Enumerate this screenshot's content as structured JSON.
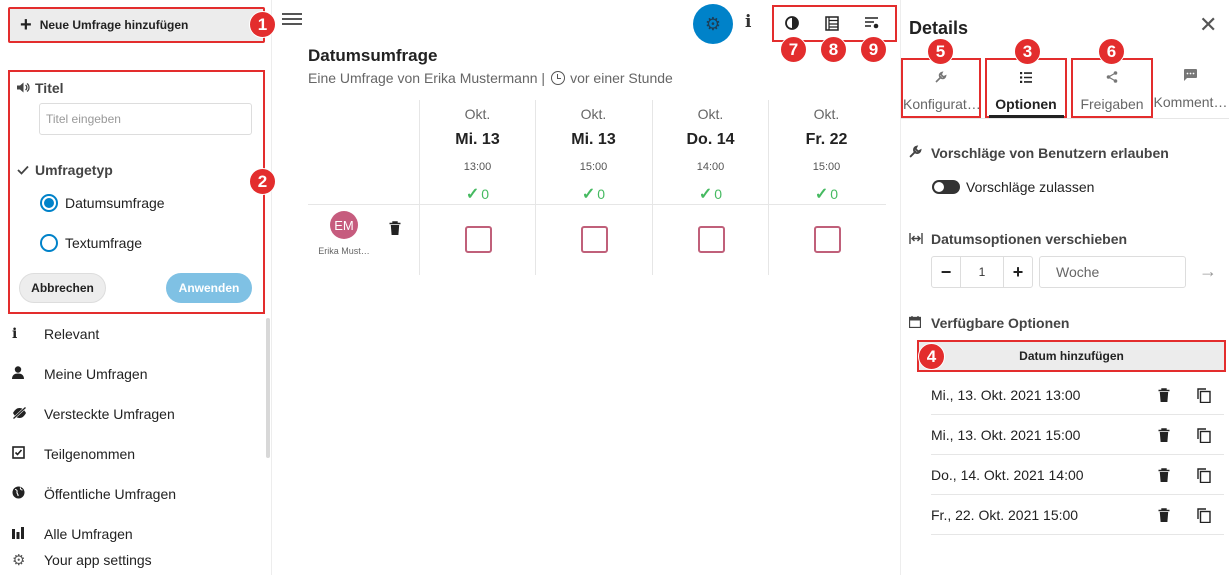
{
  "sidebar": {
    "new_poll_label": "Neue Umfrage hinzufügen",
    "form": {
      "title_heading": "Titel",
      "title_placeholder": "Titel eingeben",
      "type_heading": "Umfragetyp",
      "type_options": [
        "Datumsumfrage",
        "Textumfrage"
      ],
      "type_selected": "Datumsumfrage",
      "cancel_label": "Abbrechen",
      "apply_label": "Anwenden"
    },
    "nav_items": [
      {
        "label": "Relevant",
        "icon": "info-icon"
      },
      {
        "label": "Meine Umfragen",
        "icon": "user-icon"
      },
      {
        "label": "Versteckte Umfragen",
        "icon": "eye-off-icon"
      },
      {
        "label": "Teilgenommen",
        "icon": "checkbox-icon"
      },
      {
        "label": "Öffentliche Umfragen",
        "icon": "globe-icon"
      },
      {
        "label": "Alle Umfragen",
        "icon": "bar-chart-icon"
      }
    ],
    "settings_label": "Your app settings"
  },
  "main": {
    "poll_title": "Datumsumfrage",
    "poll_subtitle": "Eine Umfrage von Erika Mustermann |",
    "poll_age": "vor einer Stunde",
    "toolbar_icons": [
      "contrast-icon",
      "table-view-icon",
      "filter-list-icon"
    ],
    "options": [
      {
        "month": "Okt.",
        "day": "Mi. 13",
        "time": "13:00",
        "yes_count": "0"
      },
      {
        "month": "Okt.",
        "day": "Mi. 13",
        "time": "15:00",
        "yes_count": "0"
      },
      {
        "month": "Okt.",
        "day": "Do. 14",
        "time": "14:00",
        "yes_count": "0"
      },
      {
        "month": "Okt.",
        "day": "Fr. 22",
        "time": "15:00",
        "yes_count": "0"
      }
    ],
    "participant": {
      "initials": "EM",
      "name": "Erika Must…"
    }
  },
  "details": {
    "title": "Details",
    "tabs": [
      {
        "label": "Konfigurat…",
        "icon": "wrench-icon"
      },
      {
        "label": "Optionen",
        "icon": "list-icon"
      },
      {
        "label": "Freigaben",
        "icon": "share-icon"
      },
      {
        "label": "Komment…",
        "icon": "comment-icon"
      }
    ],
    "active_tab": "Optionen",
    "suggestions_heading": "Vorschläge von Benutzern erlauben",
    "suggestions_toggle_label": "Vorschläge zulassen",
    "suggestions_enabled": false,
    "shift_heading": "Datumsoptionen verschieben",
    "shift_value": "1",
    "shift_unit": "Woche",
    "available_heading": "Verfügbare Optionen",
    "add_date_label": "Datum hinzufügen",
    "date_options": [
      "Mi., 13. Okt. 2021 13:00",
      "Mi., 13. Okt. 2021 15:00",
      "Do., 14. Okt. 2021 14:00",
      "Fr., 22. Okt. 2021 15:00"
    ]
  },
  "badges": [
    "1",
    "2",
    "3",
    "4",
    "5",
    "6",
    "7",
    "8",
    "9"
  ],
  "colors": {
    "accent": "#0082c9",
    "callout": "#e32d2d",
    "yes": "#46ba61",
    "vote_box": "#c0607a",
    "avatar": "#c65c7e"
  }
}
